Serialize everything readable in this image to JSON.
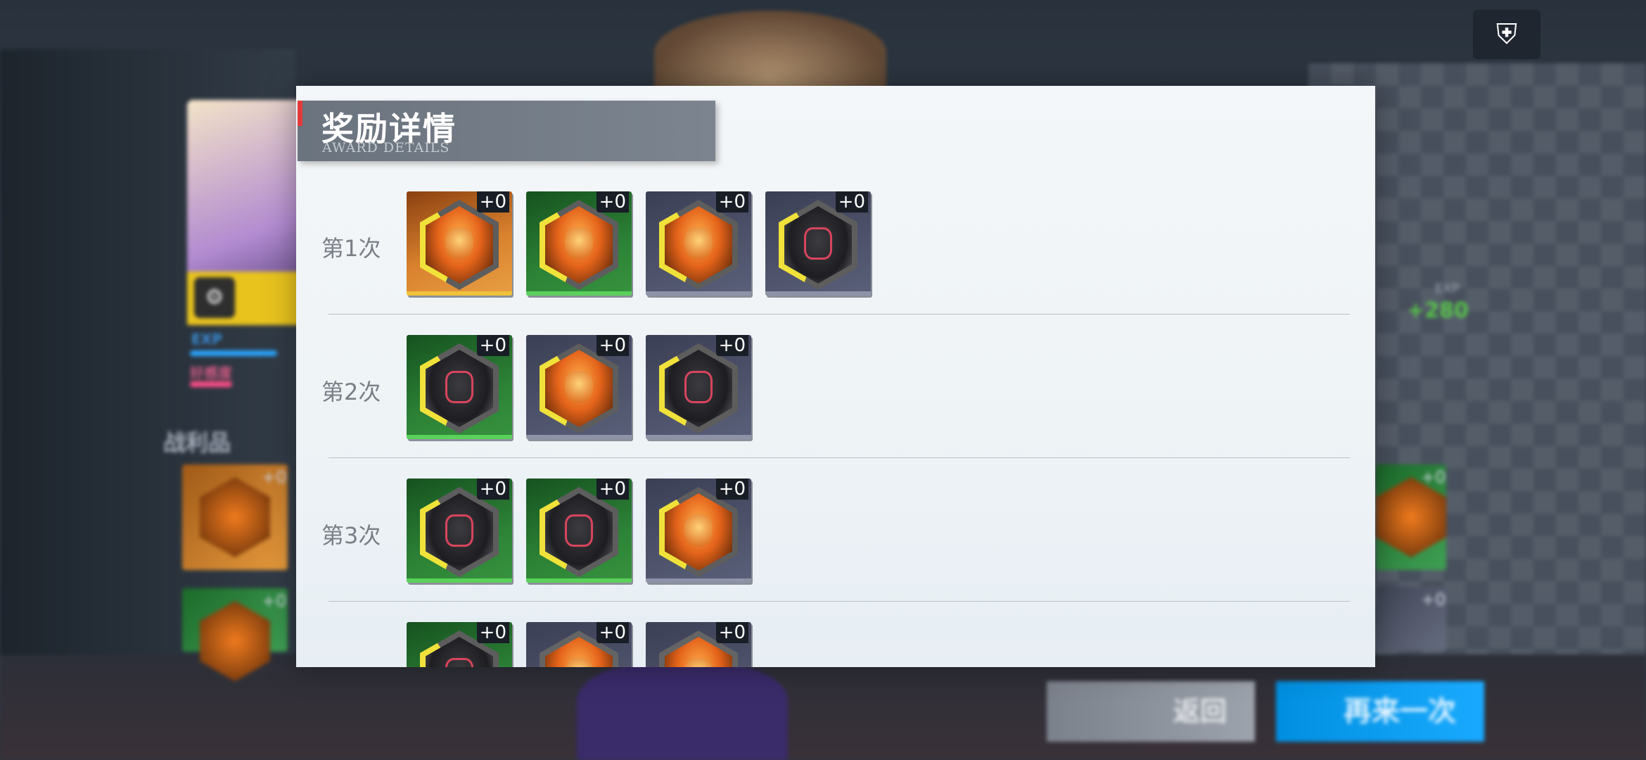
{
  "background": {
    "loot_label": "战利品",
    "exp_label": "EXP",
    "favor_label": "好感度",
    "exp_gain": "+280",
    "exp_gain_label": "EXP",
    "side_items": [
      {
        "plus": "+0",
        "frame": "orange"
      },
      {
        "plus": "+0",
        "frame": "green"
      }
    ],
    "right_items": [
      {
        "plus": "+0",
        "frame": "green"
      },
      {
        "plus": "+0",
        "frame": "gray"
      }
    ],
    "return_button": "返回",
    "again_button": "再来一次",
    "top_right_icon": "mech-icon"
  },
  "modal": {
    "title": "奖励详情",
    "subtitle": "AWARD DETAILS",
    "rounds": [
      {
        "label": "第1次",
        "items": [
          {
            "frame": "orange",
            "mask": "orange",
            "ring": "yellow",
            "plus": "+0"
          },
          {
            "frame": "green",
            "mask": "orange",
            "ring": "yellow",
            "plus": "+0"
          },
          {
            "frame": "gray",
            "mask": "orange",
            "ring": "yellow",
            "plus": "+0"
          },
          {
            "frame": "gray",
            "mask": "dark",
            "ring": "yellow",
            "plus": "+0"
          }
        ]
      },
      {
        "label": "第2次",
        "items": [
          {
            "frame": "green",
            "mask": "dark",
            "ring": "yellow",
            "plus": "+0"
          },
          {
            "frame": "gray",
            "mask": "orange",
            "ring": "yellow",
            "plus": "+0"
          },
          {
            "frame": "gray",
            "mask": "dark",
            "ring": "yellow",
            "plus": "+0"
          }
        ]
      },
      {
        "label": "第3次",
        "items": [
          {
            "frame": "green",
            "mask": "dark",
            "ring": "yellow",
            "plus": "+0"
          },
          {
            "frame": "green",
            "mask": "dark",
            "ring": "yellow",
            "plus": "+0"
          },
          {
            "frame": "gray",
            "mask": "orange",
            "ring": "yellow",
            "plus": "+0"
          }
        ]
      },
      {
        "label": "",
        "items": [
          {
            "frame": "green",
            "mask": "dark",
            "ring": "yellow",
            "plus": "+0"
          },
          {
            "frame": "gray",
            "mask": "orange",
            "ring": "gray",
            "plus": "+0"
          },
          {
            "frame": "gray",
            "mask": "orange",
            "ring": "gray",
            "plus": "+0"
          }
        ]
      }
    ]
  }
}
